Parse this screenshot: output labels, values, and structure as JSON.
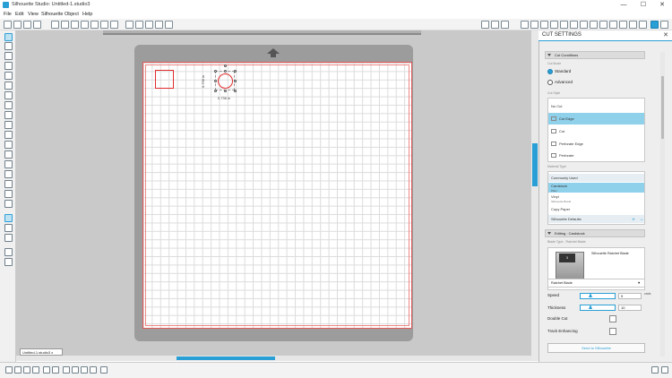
{
  "window": {
    "title": "Silhouette Studio: Untitled-1.studio3",
    "minimize": "—",
    "maximize": "☐",
    "close": "✕"
  },
  "menu": [
    "File",
    "Edit",
    "View",
    "Silhouette",
    "Object",
    "Help"
  ],
  "document_tab": {
    "label": "Untitled-1.studio3",
    "close": "x"
  },
  "canvas": {
    "width_label": "0.736 in",
    "height_label": "0.736 in"
  },
  "panel": {
    "title": "CUT SETTINGS",
    "close": "✕",
    "cut_conditions": {
      "header": "Cut Conditions",
      "cut_mode_label": "Cut Mode",
      "modes": [
        "Standard",
        "Advanced"
      ],
      "selected_mode": "Standard",
      "cut_style_label": "Cut Style",
      "styles": [
        "No Cut",
        "Cut Edge",
        "Cut",
        "Perforate Edge",
        "Perforate"
      ],
      "selected_style": "Cut Edge"
    },
    "material": {
      "label": "Material Type",
      "items": [
        {
          "name": "Commonly Used",
          "sub": ""
        },
        {
          "name": "Cardstock",
          "sub": "Plain"
        },
        {
          "name": "Vinyl",
          "sub": "Silhouette Brand"
        },
        {
          "name": "Copy Paper",
          "sub": ""
        },
        {
          "name": "Silhouette Defaults",
          "sub": ""
        }
      ],
      "selected": "Cardstock",
      "add": "+",
      "remove": "−"
    },
    "editing": {
      "header": "Editing : Cardstock",
      "blade_label": "Blade Type - Ratchet Blade",
      "blade_title": "Silhouette Ratchet Blade",
      "blade_cap_value": "3",
      "blade_select": "Ratchet Blade",
      "speed_label": "Speed",
      "speed_value": "5",
      "speed_unit": "cm/s",
      "thickness_label": "Thickness",
      "thickness_value": "10",
      "double_cut_label": "Double Cut",
      "track_enhancing_label": "Track Enhancing",
      "speed_fraction": 0.25,
      "thickness_fraction": 0.25
    },
    "send_button": "Send to Silhouette"
  },
  "colors": {
    "accent": "#2a9fd6",
    "shape": "#e02b2b"
  },
  "icons": {
    "toolbar": [
      "new-file-icon",
      "open-file-icon",
      "save-icon",
      "save-as-icon",
      "print-icon",
      "cut-icon",
      "copy-icon",
      "paste-icon",
      "delete-icon",
      "undo-icon",
      "redo-icon",
      "zoom-in-icon",
      "zoom-out-icon",
      "zoom-fit-icon",
      "pan-icon"
    ]
  }
}
